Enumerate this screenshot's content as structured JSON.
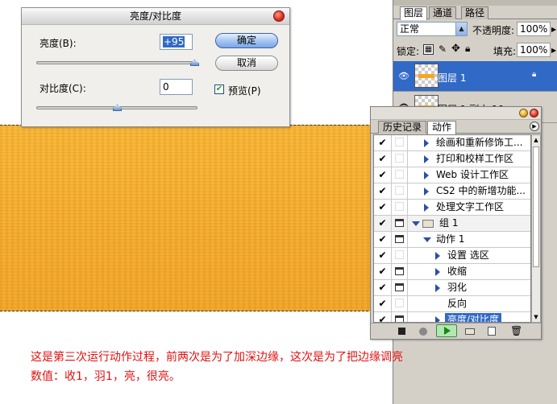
{
  "dialog": {
    "title": "亮度/对比度",
    "brightness_label": "亮度(B):",
    "brightness_value": "+95",
    "brightness_level": 0.98,
    "contrast_label": "对比度(C):",
    "contrast_value": "0",
    "contrast_level": 0.5,
    "ok_label": "确定",
    "cancel_label": "取消",
    "preview_label": "预览(P)",
    "preview_checked": true
  },
  "layers": {
    "tabs": [
      "图层",
      "通道",
      "路径"
    ],
    "active_tab": 0,
    "blend_mode": "正常",
    "opacity_label": "不透明度:",
    "opacity_value": "100%",
    "lock_label": "锁定:",
    "fill_label": "填充:",
    "fill_value": "100%",
    "items": [
      {
        "name": "图层 1",
        "selected": true
      },
      {
        "name": "图层 1 副本 10",
        "selected": false
      }
    ]
  },
  "actions": {
    "tabs": [
      "历史记录",
      "动作"
    ],
    "active_tab": 1,
    "rows": [
      {
        "label": "绘画和重新修饰工...",
        "checked": true,
        "dialog": false,
        "expand": "right",
        "indent": 1,
        "folder": false
      },
      {
        "label": "打印和校样工作区",
        "checked": true,
        "dialog": false,
        "expand": "right",
        "indent": 1,
        "folder": false
      },
      {
        "label": "Web 设计工作区",
        "checked": true,
        "dialog": false,
        "expand": "right",
        "indent": 1,
        "folder": false
      },
      {
        "label": "CS2 中的新增功能...",
        "checked": true,
        "dialog": false,
        "expand": "right",
        "indent": 1,
        "folder": false
      },
      {
        "label": "处理文字工作区",
        "checked": true,
        "dialog": false,
        "expand": "right",
        "indent": 1,
        "folder": false
      },
      {
        "label": "组 1",
        "checked": true,
        "dialog": true,
        "expand": "down",
        "indent": 0,
        "folder": true
      },
      {
        "label": "动作 1",
        "checked": true,
        "dialog": true,
        "expand": "down",
        "indent": 1,
        "folder": false
      },
      {
        "label": "设置 选区",
        "checked": true,
        "dialog": false,
        "expand": "right",
        "indent": 2,
        "folder": false
      },
      {
        "label": "收缩",
        "checked": true,
        "dialog": true,
        "expand": "right",
        "indent": 2,
        "folder": false
      },
      {
        "label": "羽化",
        "checked": true,
        "dialog": true,
        "expand": "right",
        "indent": 2,
        "folder": false
      },
      {
        "label": "反向",
        "checked": true,
        "dialog": false,
        "expand": "none",
        "indent": 2,
        "folder": false
      },
      {
        "label": "亮度/对比度",
        "checked": true,
        "dialog": true,
        "expand": "right",
        "indent": 2,
        "folder": false,
        "selected": true
      }
    ]
  },
  "caption": {
    "line1": "这是第三次运行动作过程，前两次是为了加深边缘，这次是为了把边缘调亮",
    "line2": "数值：收1，羽1，亮，很亮。"
  },
  "colors": {
    "canvas": "#f6ac2a",
    "selection": "#3169c6",
    "caption": "#e01010"
  }
}
